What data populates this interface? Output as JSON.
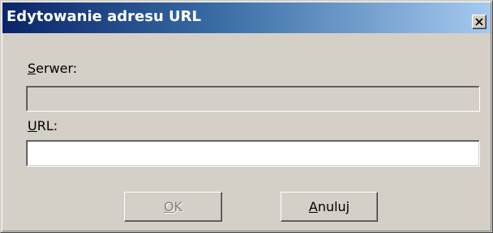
{
  "dialog": {
    "title": "Edytowanie adresu URL",
    "close_icon": "close-x-icon"
  },
  "server": {
    "label_accel": "S",
    "label_rest": "erwer:",
    "value": "",
    "disabled": true
  },
  "url": {
    "label_accel": "U",
    "label_rest": "RL:",
    "value": ""
  },
  "buttons": {
    "ok_accel": "O",
    "ok_rest": "K",
    "ok_disabled": true,
    "cancel_accel": "A",
    "cancel_rest": "nuluj"
  },
  "colors": {
    "title_gradient_start": "#0a246a",
    "title_gradient_end": "#a6caf0",
    "face": "#d4d0c8"
  }
}
